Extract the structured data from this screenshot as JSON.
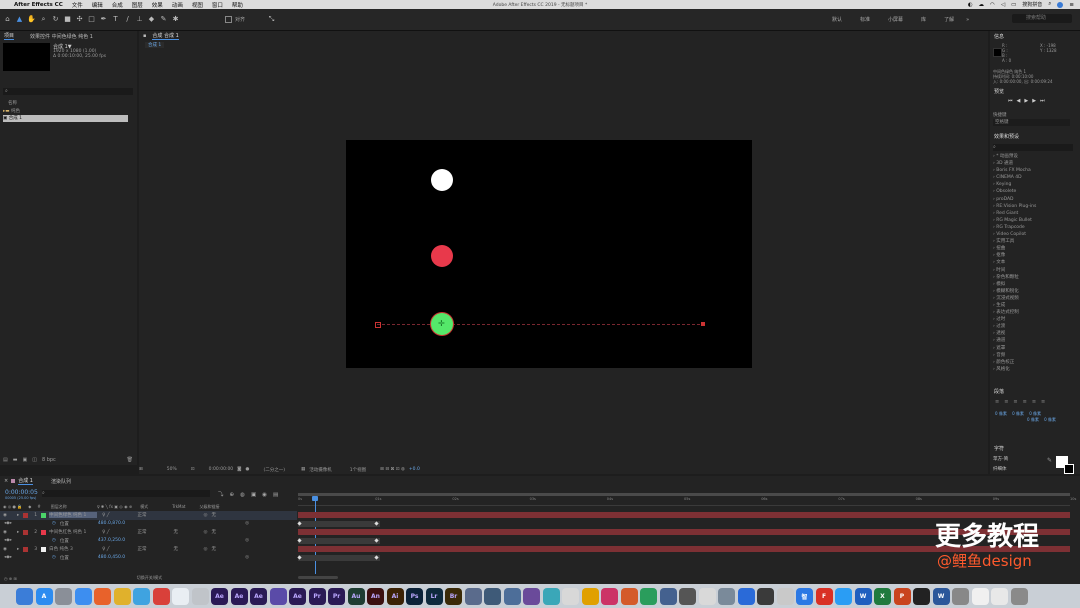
{
  "menubar": {
    "app_name": "After Effects CC",
    "menus": [
      "文件",
      "编辑",
      "合成",
      "图层",
      "效果",
      "动画",
      "视图",
      "窗口",
      "帮助"
    ],
    "window_title": "Adobe After Effects CC 2019 - 无标题项目 *",
    "input_method": "搜狗拼音"
  },
  "toolbar": {
    "snap_label": "对齐",
    "workspaces": [
      "默认",
      "标准",
      "小屏幕",
      "库",
      "了解"
    ],
    "search_placeholder": "搜索帮助"
  },
  "project_panel": {
    "tab_project": "项目",
    "tab_effect_controls": "效果控件 中间色绿色 纯色 1",
    "comp_name": "合成 1▼",
    "comp_size": "1920 x 1080 (1.00)",
    "comp_duration": "Δ 0:00:10:00, 25.00 fps",
    "column_name": "名称",
    "items": [
      "纯色",
      "合成 1"
    ],
    "footer_bpc": "8 bpc"
  },
  "viewer": {
    "tab_label": "合成 合成 1",
    "breadcrumb": "合成 1",
    "zoom": "50%",
    "timecode": "0:00:00:00",
    "resolution": "(二分之一)",
    "camera": "活动摄像机",
    "views": "1个视图",
    "exposure": "+0.0"
  },
  "info_panel": {
    "title": "信息",
    "rgb": [
      "R :",
      "G :",
      "B :",
      "A : 0"
    ],
    "coords": [
      "X : -198",
      "Y : 1328"
    ],
    "layer_name": "中间色绿色 纯色 1",
    "duration": "持续时间: 0:00:10:00",
    "inout": "入: 0:00:00:00, 出: 0:00:09:24"
  },
  "preview_panel": {
    "title": "预览",
    "shortcut_label": "快捷键",
    "shortcut_value": "空格键"
  },
  "effects_panel": {
    "title": "效果和预设",
    "items": [
      "* 动画预设",
      "3D 通道",
      "Boris FX Mocha",
      "CINEMA 4D",
      "Keying",
      "Obsolete",
      "proDAD",
      "RE:Vision Plug-ins",
      "Red Giant",
      "RG Magic Bullet",
      "RG Trapcode",
      "Video Copilot",
      "实用工具",
      "扭曲",
      "抠像",
      "文本",
      "时间",
      "杂色和颗粒",
      "模拟",
      "模糊和锐化",
      "沉浸式视频",
      "生成",
      "表达式控制",
      "过时",
      "过渡",
      "透视",
      "通道",
      "遮罩",
      "音频",
      "颜色校正",
      "风格化"
    ]
  },
  "paragraph_panel": {
    "title": "段落",
    "fields": [
      "0 像素",
      "0 像素",
      "0 像素",
      "0 像素",
      "0 像素"
    ]
  },
  "character_panel": {
    "title": "字符",
    "font": "苹方-简",
    "style": "纤细体"
  },
  "timeline": {
    "tab_comp": "合成 1",
    "tab_render": "渲染队列",
    "timecode": "0:00:00:05",
    "frame_info": "00005 (25.00 fps)",
    "columns": {
      "name": "图层名称",
      "mode": "模式",
      "trkmat": "TrkMat",
      "parent": "父级和链接"
    },
    "layers": [
      {
        "num": "1",
        "name": "中间色绿色 纯色 1",
        "color": "#4bd46a",
        "mode": "正常",
        "trkmat": "",
        "parent": "无",
        "prop": "位置",
        "value": "480.0,870.0"
      },
      {
        "num": "2",
        "name": "中间色红色 纯色 1",
        "color": "#e8394b",
        "mode": "正常",
        "trkmat": "无",
        "parent": "无",
        "prop": "位置",
        "value": "437.0,250.0"
      },
      {
        "num": "3",
        "name": "白色 纯色 3",
        "color": "#f0f0f0",
        "mode": "正常",
        "trkmat": "无",
        "parent": "无",
        "prop": "位置",
        "value": "480.0,450.0"
      }
    ],
    "ruler_marks": [
      "0s",
      "01s",
      "02s",
      "03s",
      "04s",
      "05s",
      "06s",
      "07s",
      "08s",
      "09s",
      "10s"
    ],
    "footer_mode": "切换开关/模式"
  },
  "watermark": {
    "line1": "更多教程",
    "line2": "@鲤鱼design"
  },
  "dock": {
    "apps": [
      {
        "label": "",
        "color": "#3b7dd8",
        "name": "finder"
      },
      {
        "label": "A",
        "color": "#2d8cf0",
        "name": "app-store"
      },
      {
        "label": "",
        "color": "#8a8f98",
        "name": "launchpad"
      },
      {
        "label": "",
        "color": "#3d8ef0",
        "name": "safari"
      },
      {
        "label": "",
        "color": "#e8622b",
        "name": "firefox"
      },
      {
        "label": "",
        "color": "#e0b12c",
        "name": "chrome"
      },
      {
        "label": "",
        "color": "#3fa3e0",
        "name": "qq-browser"
      },
      {
        "label": "",
        "color": "#d9403a",
        "name": "photos"
      },
      {
        "label": "",
        "color": "#e9eef3",
        "name": "baidu-netdisk"
      },
      {
        "label": "",
        "color": "#c0c4c9",
        "name": "pen-tool"
      },
      {
        "label": "Ae",
        "color": "#2a1a55",
        "name": "after-effects-1"
      },
      {
        "label": "Ae",
        "color": "#2a1a55",
        "name": "after-effects-2"
      },
      {
        "label": "Ae",
        "color": "#2a1a55",
        "name": "after-effects-3"
      },
      {
        "label": "",
        "color": "#5a4ba8",
        "name": "media-encoder-alt"
      },
      {
        "label": "Ae",
        "color": "#2a1a55",
        "name": "after-effects-4"
      },
      {
        "label": "Pr",
        "color": "#2a1a55",
        "name": "premiere-1"
      },
      {
        "label": "Pr",
        "color": "#2a1a55",
        "name": "premiere-2"
      },
      {
        "label": "Au",
        "color": "#1e3d32",
        "name": "audition"
      },
      {
        "label": "An",
        "color": "#3b1010",
        "name": "animate"
      },
      {
        "label": "Ai",
        "color": "#3b2205",
        "name": "illustrator"
      },
      {
        "label": "Ps",
        "color": "#0b2238",
        "name": "photoshop"
      },
      {
        "label": "Lr",
        "color": "#0e2a3d",
        "name": "lightroom"
      },
      {
        "label": "Br",
        "color": "#3a2a08",
        "name": "bridge"
      },
      {
        "label": "",
        "color": "#5a6b8c",
        "name": "app-24"
      },
      {
        "label": "",
        "color": "#3e5a78",
        "name": "app-25"
      },
      {
        "label": "",
        "color": "#4d6e99",
        "name": "app-26"
      },
      {
        "label": "",
        "color": "#6a4a9a",
        "name": "app-27"
      },
      {
        "label": "",
        "color": "#3aa7b8",
        "name": "app-28"
      },
      {
        "label": "",
        "color": "#d8d8d8",
        "name": "app-29"
      },
      {
        "label": "",
        "color": "#e0a000",
        "name": "app-30"
      },
      {
        "label": "",
        "color": "#cc3366",
        "name": "app-31"
      },
      {
        "label": "",
        "color": "#d45a2a",
        "name": "app-32"
      },
      {
        "label": "",
        "color": "#2a9d5c",
        "name": "app-33"
      },
      {
        "label": "",
        "color": "#44618f",
        "name": "app-34"
      },
      {
        "label": "",
        "color": "#555",
        "name": "app-35"
      },
      {
        "label": "",
        "color": "#d9d9d9",
        "name": "app-36"
      },
      {
        "label": "",
        "color": "#7a8a9a",
        "name": "app-37"
      },
      {
        "label": "",
        "color": "#2a6ad8",
        "name": "app-38"
      },
      {
        "label": "",
        "color": "#3a3a3a",
        "name": "app-39"
      },
      {
        "label": "",
        "color": "#c9c9c9",
        "name": "app-40"
      },
      {
        "label": "智",
        "color": "#2b78e4",
        "name": "zhihu"
      },
      {
        "label": "F",
        "color": "#d93025",
        "name": "filezilla"
      },
      {
        "label": "",
        "color": "#2a9df4",
        "name": "app-43"
      },
      {
        "label": "W",
        "color": "#1f5fbf",
        "name": "word"
      },
      {
        "label": "X",
        "color": "#1f7a3e",
        "name": "excel"
      },
      {
        "label": "P",
        "color": "#c9441e",
        "name": "powerpoint"
      },
      {
        "label": "",
        "color": "#222",
        "name": "qq"
      },
      {
        "label": "W",
        "color": "#2b579a",
        "name": "wps"
      },
      {
        "label": "",
        "color": "#888",
        "name": "app-49"
      },
      {
        "label": "",
        "color": "#f0f0f0",
        "name": "notes"
      },
      {
        "label": "",
        "color": "#e8e8e8",
        "name": "app-51"
      },
      {
        "label": "",
        "color": "#8a8a8a",
        "name": "trash"
      }
    ]
  }
}
